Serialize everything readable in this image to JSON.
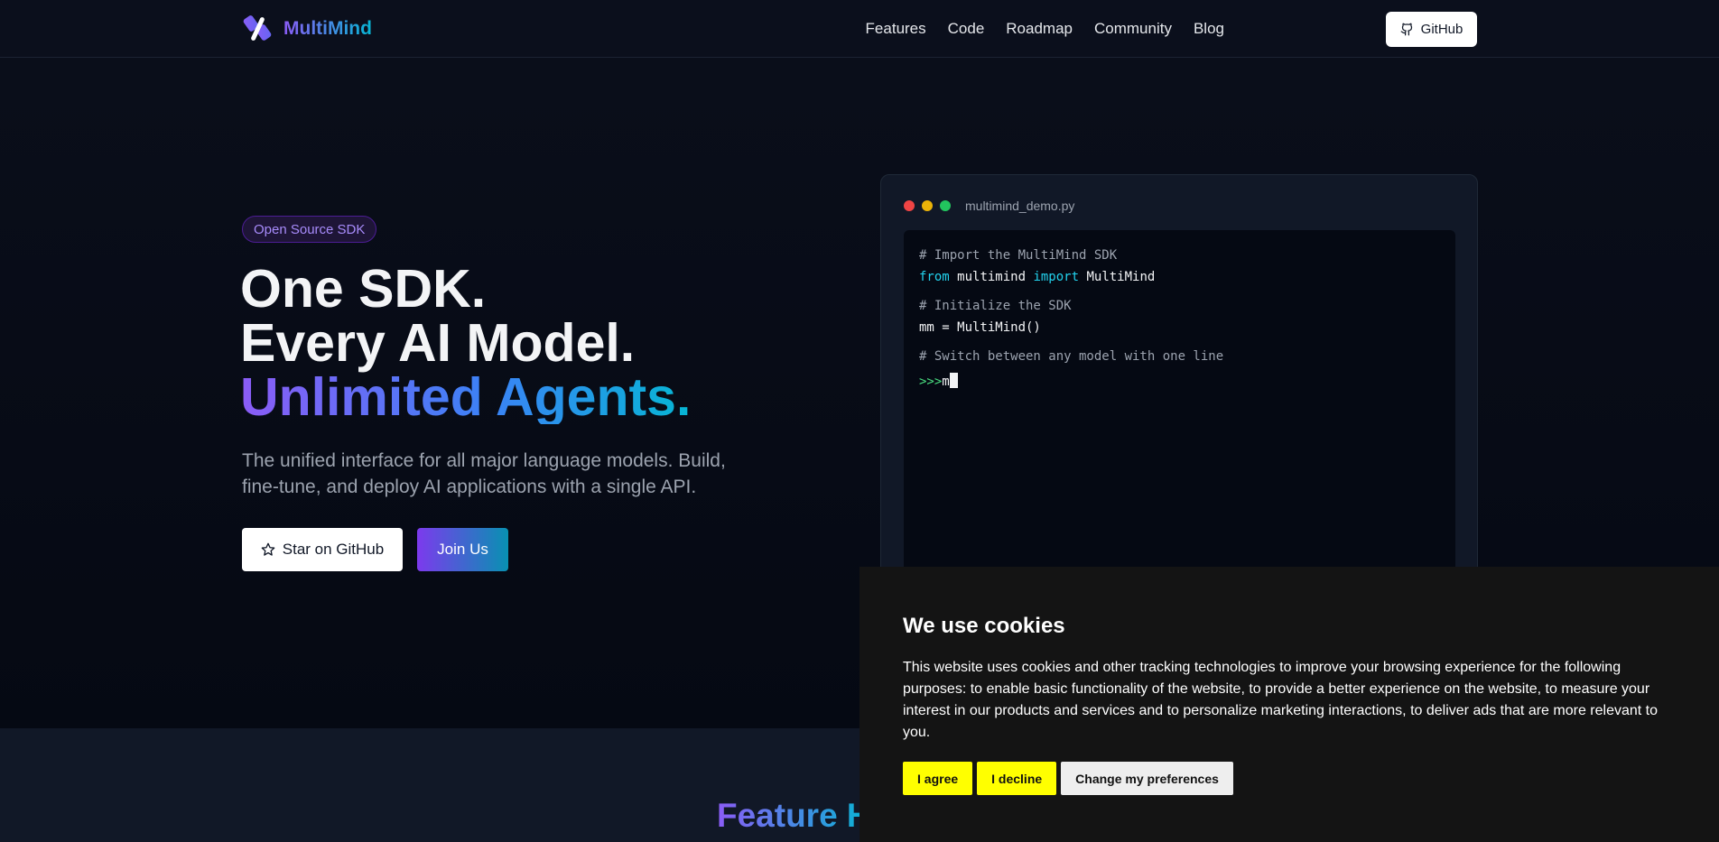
{
  "nav": {
    "brand": "MultiMind",
    "links": [
      "Features",
      "Code",
      "Roadmap",
      "Community",
      "Blog"
    ],
    "github_label": "GitHub"
  },
  "hero": {
    "badge": "Open Source SDK",
    "headline_line1": "One SDK.",
    "headline_line2": "Every AI Model.",
    "headline_line3": "Unlimited Agents.",
    "subtitle": "The unified interface for all major language models. Build, fine-tune, and deploy AI applications with a single API.",
    "star_button": "Star on GitHub",
    "join_button": "Join Us"
  },
  "code": {
    "filename": "multimind_demo.py",
    "comment1": "# Import the MultiMind SDK",
    "kw_from": "from",
    "module": "multimind",
    "kw_import": "import",
    "class_name": "MultiMind",
    "comment2": "# Initialize the SDK",
    "init_line": "mm = MultiMind()",
    "comment3": "# Switch between any model with one line",
    "prompt": ">>>",
    "typed": "m"
  },
  "feature": {
    "title_partial": "Feature H"
  },
  "cookie": {
    "title": "We use cookies",
    "text": "This website uses cookies and other tracking technologies to improve your browsing experience for the following purposes: to enable basic functionality of the website, to provide a better experience on the website, to measure your interest in our products and services and to personalize marketing interactions, to deliver ads that are more relevant to you.",
    "agree": "I agree",
    "decline": "I decline",
    "preferences": "Change my preferences"
  },
  "colors": {
    "accent_purple": "#8b5cf6",
    "accent_cyan": "#06b6d4",
    "cookie_button_yellow": "#ffff00",
    "dot_red": "#ef4444",
    "dot_yellow": "#eab308",
    "dot_green": "#22c55e"
  },
  "icons": {
    "brand": "multimind-logo-icon",
    "github": "github-icon",
    "star": "star-icon"
  }
}
